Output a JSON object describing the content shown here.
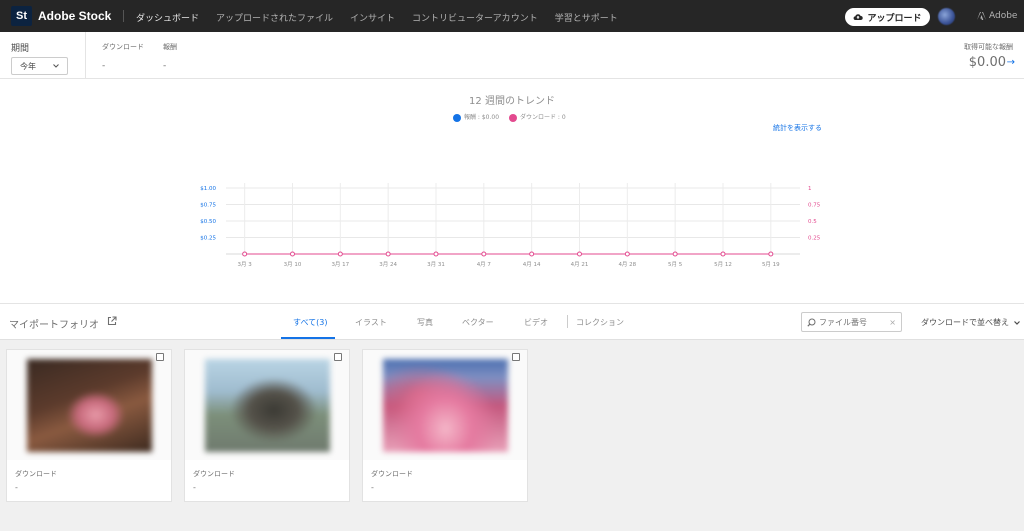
{
  "app": {
    "logo_text": "St",
    "brand": "Adobe Stock",
    "adobe_label": "Adobe"
  },
  "nav": {
    "items": [
      "ダッシュボード",
      "アップロードされたファイル",
      "インサイト",
      "コントリビューターアカウント",
      "学習とサポート"
    ]
  },
  "header": {
    "upload_label": "アップロード"
  },
  "stats": {
    "period_label": "期間",
    "period_value": "今年",
    "downloads_label": "ダウンロード",
    "downloads_value": "-",
    "earnings_label": "報酬",
    "earnings_value": "-",
    "available_label": "取得可能な報酬",
    "available_value": "$0.00"
  },
  "chart": {
    "title": "12 週間のトレンド",
    "legend_earnings": "報酬 : $0.00",
    "legend_downloads": "ダウンロード : 0",
    "show_stats": "統計を表示する"
  },
  "chart_data": {
    "type": "line",
    "title": "12 週間のトレンド",
    "x": [
      "3月 3",
      "3月 10",
      "3月 17",
      "3月 24",
      "3月 31",
      "4月 7",
      "4月 14",
      "4月 21",
      "4月 28",
      "5月 5",
      "5月 12",
      "5月 19"
    ],
    "y_left_ticks": [
      "$1.00",
      "$0.75",
      "$0.50",
      "$0.25"
    ],
    "y_right_ticks": [
      "1",
      "0.75",
      "0.5",
      "0.25"
    ],
    "y_left_range": [
      0,
      1
    ],
    "y_right_range": [
      0,
      1
    ],
    "series": [
      {
        "name": "報酬",
        "axis": "left",
        "color": "#1473e6",
        "values": [
          0,
          0,
          0,
          0,
          0,
          0,
          0,
          0,
          0,
          0,
          0,
          0
        ]
      },
      {
        "name": "ダウンロード",
        "axis": "right",
        "color": "#e34a8f",
        "values": [
          0,
          0,
          0,
          0,
          0,
          0,
          0,
          0,
          0,
          0,
          0,
          0
        ]
      }
    ],
    "grid": true
  },
  "portfolio": {
    "title": "マイポートフォリオ",
    "tabs": [
      "すべて(3)",
      "イラスト",
      "写真",
      "ベクター",
      "ビデオ",
      "コレクション"
    ],
    "search_placeholder": "ファイル番号",
    "sort_label": "ダウンロードで並べ替え"
  },
  "cards": [
    {
      "downloads_label": "ダウンロード",
      "downloads_value": "-"
    },
    {
      "downloads_label": "ダウンロード",
      "downloads_value": "-"
    },
    {
      "downloads_label": "ダウンロード",
      "downloads_value": "-"
    }
  ],
  "colors": {
    "accent": "#1473e6",
    "downloads": "#e34a8f",
    "topbar": "#262626"
  }
}
